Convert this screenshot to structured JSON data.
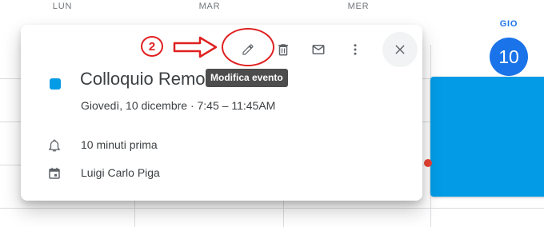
{
  "calendar": {
    "day_headers": [
      "LUN",
      "MAR",
      "MER"
    ],
    "today": {
      "label": "GIO",
      "number": "10"
    }
  },
  "popup": {
    "event_title": "Colloquio Remoto",
    "event_datetime": "Giovedì, 10 dicembre  ·  7:45 – 11:45AM",
    "notification": "10 minuti prima",
    "calendar_owner": "Luigi Carlo Piga",
    "event_color": "#039be5",
    "toolbar": {
      "edit_icon": "pencil-icon",
      "delete_icon": "trash-icon",
      "email_icon": "envelope-icon",
      "more_icon": "more-vert-icon",
      "close_icon": "close-icon"
    },
    "tooltip": "Modifica evento"
  },
  "annotation": {
    "step_number": "2",
    "color": "#e02020"
  }
}
